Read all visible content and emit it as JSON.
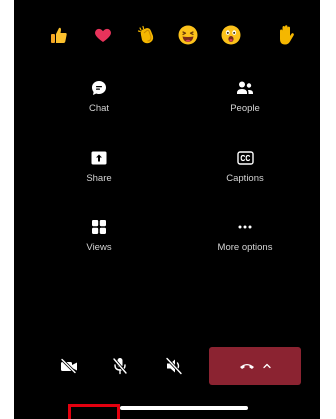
{
  "colors": {
    "background": "#000000",
    "label": "#d4d4d4",
    "icon": "#ffffff",
    "hangup": "#8b2331",
    "highlight": "#e3000f"
  },
  "reactions": [
    {
      "name": "like",
      "icon": "thumbs-up-icon"
    },
    {
      "name": "heart",
      "icon": "heart-icon"
    },
    {
      "name": "applause",
      "icon": "clapping-hands-icon"
    },
    {
      "name": "laugh",
      "icon": "laughing-face-icon"
    },
    {
      "name": "surprised",
      "icon": "surprised-face-icon"
    },
    {
      "name": "raise-hand",
      "icon": "raised-hand-icon"
    }
  ],
  "menu": {
    "chat_label": "Chat",
    "people_label": "People",
    "share_label": "Share",
    "captions_label": "Captions",
    "views_label": "Views",
    "more_label": "More options"
  },
  "controls": {
    "camera_icon": "camera-off-icon",
    "mic_icon": "mic-off-icon",
    "speaker_icon": "speaker-off-icon",
    "hangup_icon": "phone-hangup-icon",
    "expand_icon": "chevron-up-icon"
  }
}
